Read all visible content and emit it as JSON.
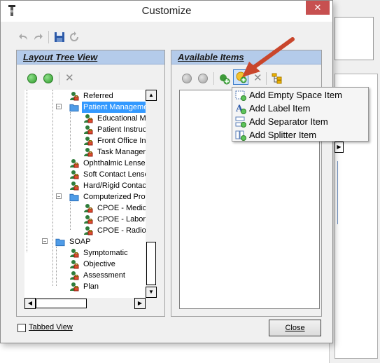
{
  "window": {
    "title": "Customize",
    "close_glyph": "✕"
  },
  "toolbar": {
    "icons": [
      "undo-icon",
      "redo-icon",
      "save-icon",
      "reset-icon"
    ]
  },
  "layout_tree": {
    "header": "Layout Tree View",
    "toolbar_icons": [
      "expand-all-icon",
      "collapse-all-icon",
      "delete-icon"
    ],
    "items": [
      {
        "label": "Referred",
        "kind": "item",
        "level": 3
      },
      {
        "label": "Patient Manageme",
        "kind": "group",
        "level": 3,
        "selected": true
      },
      {
        "label": "Educational Ma",
        "kind": "item",
        "level": 4
      },
      {
        "label": "Patient Instruct",
        "kind": "item",
        "level": 4
      },
      {
        "label": "Front Office Ins",
        "kind": "item",
        "level": 4
      },
      {
        "label": "Task Manager",
        "kind": "item",
        "level": 4
      },
      {
        "label": "Ophthalmic Lenses",
        "kind": "item",
        "level": 3
      },
      {
        "label": "Soft Contact Lense",
        "kind": "item",
        "level": 3
      },
      {
        "label": "Hard/Rigid Contac",
        "kind": "item",
        "level": 3
      },
      {
        "label": "Computerized Prov",
        "kind": "group",
        "level": 3
      },
      {
        "label": "CPOE - Medica",
        "kind": "item",
        "level": 4
      },
      {
        "label": "CPOE - Labora",
        "kind": "item",
        "level": 4
      },
      {
        "label": "CPOE - Radiolo",
        "kind": "item",
        "level": 4
      },
      {
        "label": "SOAP",
        "kind": "group",
        "level": 2
      },
      {
        "label": "Symptomatic",
        "kind": "item",
        "level": 3
      },
      {
        "label": "Objective",
        "kind": "item",
        "level": 3
      },
      {
        "label": "Assessment",
        "kind": "item",
        "level": 3
      },
      {
        "label": "Plan",
        "kind": "item",
        "level": 3
      }
    ]
  },
  "available_items": {
    "header": "Available Items",
    "toolbar_icons": [
      "move-up-icon",
      "move-down-icon",
      "add-item-icon",
      "add-new-item-icon",
      "delete-icon",
      "tree-view-icon"
    ],
    "menu": [
      {
        "label": "Add Empty Space Item",
        "icon": "empty-space-icon"
      },
      {
        "label": "Add Label Item",
        "icon": "label-item-icon"
      },
      {
        "label": "Add Separator Item",
        "icon": "separator-item-icon"
      },
      {
        "label": "Add Splitter Item",
        "icon": "splitter-item-icon"
      }
    ]
  },
  "footer": {
    "tabbed_view_label": "Tabbed View",
    "tabbed_view_checked": false,
    "close_label": "Close"
  },
  "colors": {
    "panel_header": "#b4cbea",
    "selection": "#3399ff",
    "close_button": "#c75050",
    "annotation_arrow": "#c9462c"
  }
}
